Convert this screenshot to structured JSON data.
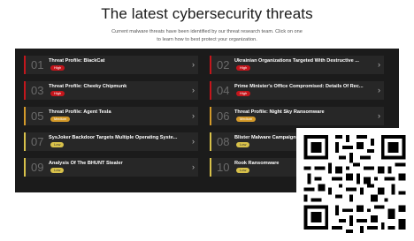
{
  "header": {
    "title": "The latest cybersecurity threats",
    "subtitle_line1": "Current malware threats have been identified by our threat research team. Click on one",
    "subtitle_line2": "to learn how to best protect your organization."
  },
  "threats": [
    {
      "num": "01",
      "title": "Threat Profile: BlackCat",
      "severity": "High"
    },
    {
      "num": "02",
      "title": "Ukrainian Organizations Targeted With Destructive ...",
      "severity": "High"
    },
    {
      "num": "03",
      "title": "Threat Profile: Cheeky Chipmunk",
      "severity": "High"
    },
    {
      "num": "04",
      "title": "Prime Minister's Office Compromised: Details Of Rec...",
      "severity": "High"
    },
    {
      "num": "05",
      "title": "Threat Profile: Agent Tesla",
      "severity": "Medium"
    },
    {
      "num": "06",
      "title": "Threat Profile: Night Sky Ransomware",
      "severity": "Medium"
    },
    {
      "num": "07",
      "title": "SysJoker Backdoor Targets Multiple Operating Syste...",
      "severity": "Low"
    },
    {
      "num": "08",
      "title": "Blister Malware Campaign Uni",
      "severity": "Low"
    },
    {
      "num": "09",
      "title": "Analysis Of The BHUNT Stealer",
      "severity": "Low"
    },
    {
      "num": "10",
      "title": "Rook Ransomware",
      "severity": "Low"
    }
  ],
  "icons": {
    "chevron": "chevron-right-icon",
    "qr": "qr-code"
  },
  "colors": {
    "high": "#c4161c",
    "medium": "#d49a2a",
    "low": "#d8c14a",
    "panel": "#1b1b1b"
  }
}
